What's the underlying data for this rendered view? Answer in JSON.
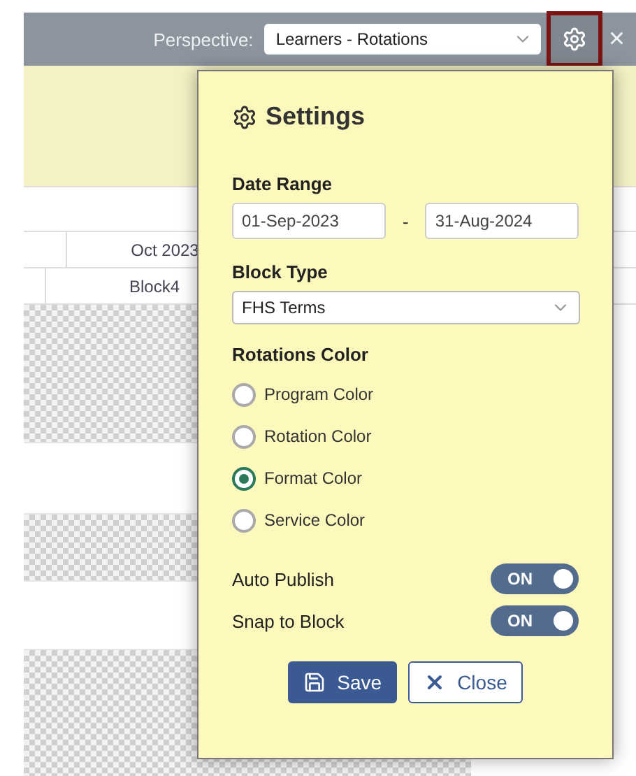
{
  "topbar": {
    "perspective_label": "Perspective:",
    "perspective_value": "Learners - Rotations",
    "close": "×"
  },
  "grid": {
    "month": "Oct 2023",
    "block": "Block4",
    "rows": [
      {
        "kind": "hatched"
      },
      {
        "kind": "plain"
      },
      {
        "kind": "hatched"
      },
      {
        "kind": "plain"
      },
      {
        "kind": "hatched"
      }
    ]
  },
  "settings": {
    "title": "Settings",
    "date_range_label": "Date Range",
    "start": "01-Sep-2023",
    "separator": "-",
    "end": "31-Aug-2024",
    "block_type_label": "Block Type",
    "block_type": "FHS Terms",
    "color_label": "Rotations Color",
    "color_options": [
      {
        "label": "Program Color",
        "selected": false
      },
      {
        "label": "Rotation Color",
        "selected": false
      },
      {
        "label": "Format Color",
        "selected": true
      },
      {
        "label": "Service Color",
        "selected": false
      }
    ],
    "toggles": [
      {
        "label": "Auto Publish",
        "on": true,
        "text": "ON"
      },
      {
        "label": "Snap to Block",
        "on": true,
        "text": "ON"
      }
    ],
    "buttons": [
      {
        "kind": "save",
        "label": "Save"
      },
      {
        "kind": "close",
        "label": "Close"
      }
    ]
  }
}
